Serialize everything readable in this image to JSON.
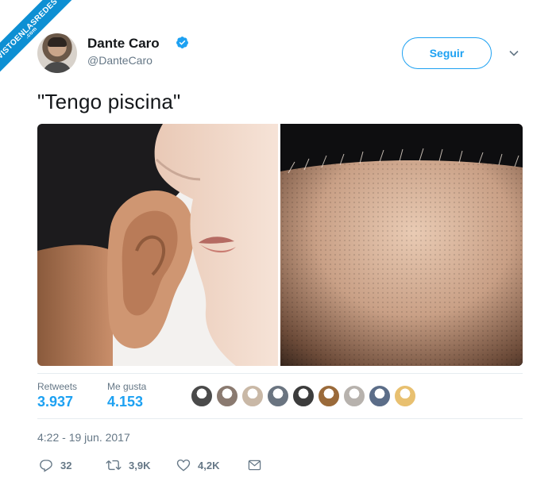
{
  "watermark": {
    "line1": "VISTOENLASREDES",
    "line2": ".com"
  },
  "author": {
    "name": "Dante Caro",
    "handle": "@DanteCaro"
  },
  "follow_button": {
    "label": "Seguir"
  },
  "tweet": {
    "text": "\"Tengo piscina\""
  },
  "stats": {
    "retweets_label": "Retweets",
    "retweets_value": "3.937",
    "likes_label": "Me gusta",
    "likes_value": "4.153"
  },
  "likers": [
    {
      "name": "liker-avatar",
      "color": "#4a4a4a"
    },
    {
      "name": "liker-avatar",
      "color": "#8a7a70"
    },
    {
      "name": "liker-avatar",
      "color": "#c9b8a6"
    },
    {
      "name": "liker-avatar",
      "color": "#6a7480"
    },
    {
      "name": "liker-avatar",
      "color": "#3c3c3c"
    },
    {
      "name": "liker-avatar",
      "color": "#9a6a3a"
    },
    {
      "name": "liker-avatar",
      "color": "#b7b2ad"
    },
    {
      "name": "liker-avatar",
      "color": "#5b6d88"
    },
    {
      "name": "liker-avatar",
      "color": "#e8c070"
    }
  ],
  "timestamp": "4:22 - 19 jun. 2017",
  "actions": {
    "reply_count": "32",
    "retweet_count": "3,9K",
    "like_count": "4,2K"
  },
  "colors": {
    "accent": "#1da1f2",
    "text": "#14171a",
    "muted": "#657786"
  },
  "icons": [
    "verified-badge-icon",
    "chevron-down-icon",
    "reply-icon",
    "retweet-icon",
    "heart-icon",
    "message-icon"
  ]
}
